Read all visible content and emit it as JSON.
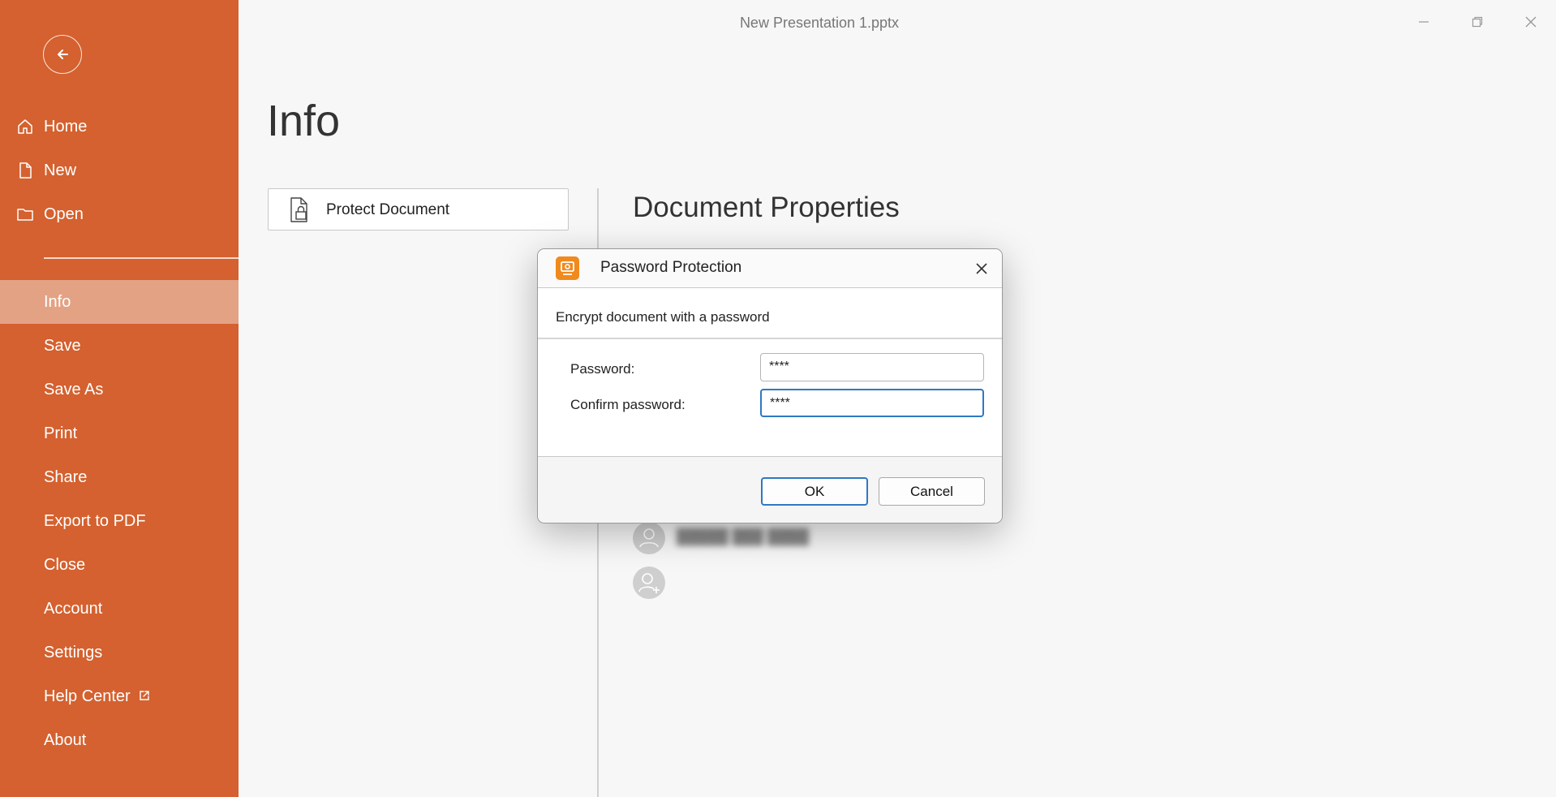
{
  "window": {
    "title": "New Presentation 1.pptx"
  },
  "sidebar": {
    "items": [
      {
        "label": "Home",
        "icon": "home-icon"
      },
      {
        "label": "New",
        "icon": "new-document-icon"
      },
      {
        "label": "Open",
        "icon": "folder-icon"
      },
      {
        "label": "Info",
        "active": true
      },
      {
        "label": "Save"
      },
      {
        "label": "Save As"
      },
      {
        "label": "Print"
      },
      {
        "label": "Share"
      },
      {
        "label": "Export to PDF"
      },
      {
        "label": "Close"
      },
      {
        "label": "Account"
      },
      {
        "label": "Settings"
      },
      {
        "label": "Help Center",
        "icon": "external-link-icon"
      },
      {
        "label": "About"
      }
    ]
  },
  "main": {
    "title": "Info",
    "protect_button": "Protect Document",
    "properties_title": "Document Properties"
  },
  "dialog": {
    "title": "Password Protection",
    "subtitle": "Encrypt document with a password",
    "password_label": "Password:",
    "password_value": "****",
    "confirm_label": "Confirm password:",
    "confirm_value": "****",
    "ok_label": "OK",
    "cancel_label": "Cancel"
  },
  "colors": {
    "sidebar_bg": "#d4612f",
    "sidebar_active": "#e3a284",
    "accent_focus": "#2f78c4",
    "app_icon": "#f08a1d"
  }
}
